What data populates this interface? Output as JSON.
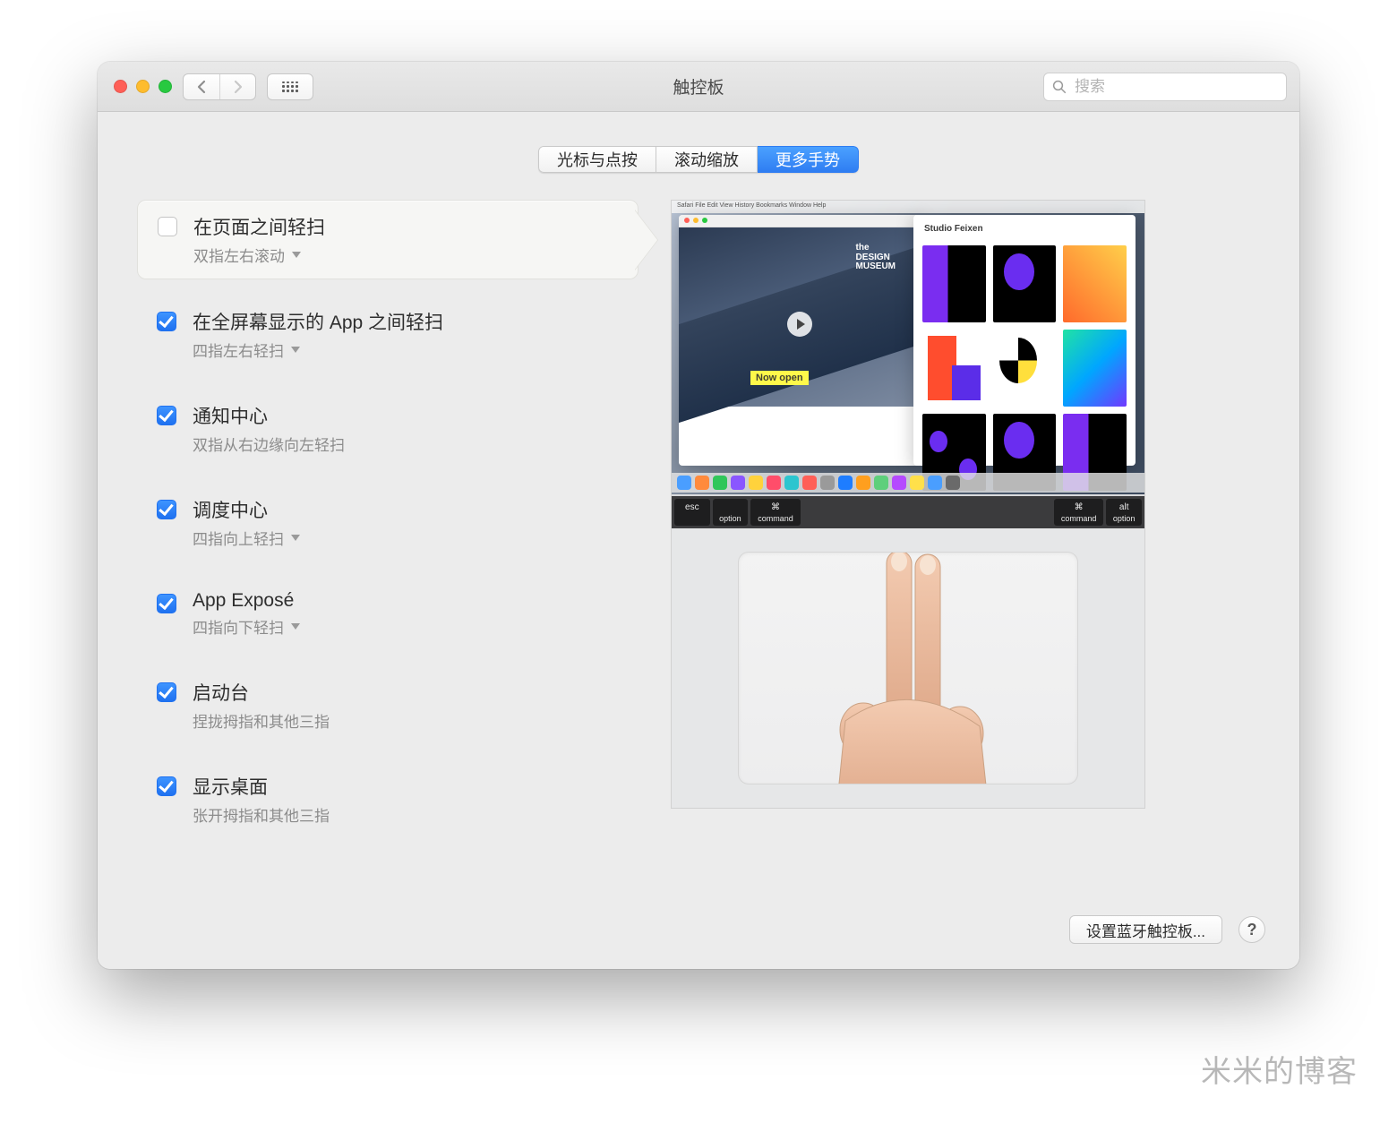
{
  "window": {
    "title": "触控板"
  },
  "search": {
    "placeholder": "搜索"
  },
  "tabs": [
    {
      "label": "光标与点按",
      "active": false
    },
    {
      "label": "滚动缩放",
      "active": false
    },
    {
      "label": "更多手势",
      "active": true
    }
  ],
  "options": [
    {
      "title": "在页面之间轻扫",
      "sub": "双指左右滚动",
      "checked": false,
      "dropdown": true,
      "highlight": true
    },
    {
      "title": "在全屏幕显示的 App 之间轻扫",
      "sub": "四指左右轻扫",
      "checked": true,
      "dropdown": true,
      "highlight": false
    },
    {
      "title": "通知中心",
      "sub": "双指从右边缘向左轻扫",
      "checked": true,
      "dropdown": false,
      "highlight": false
    },
    {
      "title": "调度中心",
      "sub": "四指向上轻扫",
      "checked": true,
      "dropdown": true,
      "highlight": false
    },
    {
      "title": "App Exposé",
      "sub": "四指向下轻扫",
      "checked": true,
      "dropdown": true,
      "highlight": false
    },
    {
      "title": "启动台",
      "sub": "捏拢拇指和其他三指",
      "checked": true,
      "dropdown": false,
      "highlight": false
    },
    {
      "title": "显示桌面",
      "sub": "张开拇指和其他三指",
      "checked": true,
      "dropdown": false,
      "highlight": false
    }
  ],
  "preview": {
    "menu_bar": "Safari  File  Edit  View  History  Bookmarks  Window  Help",
    "design_museum": "the\nDESIGN\nMUSEUM",
    "now_open": "Now open",
    "studio": "Studio Feixen",
    "keys": {
      "esc": "esc",
      "cmd_sym": "⌘",
      "command": "command",
      "option": "option",
      "alt": "alt"
    }
  },
  "footer": {
    "bluetooth": "设置蓝牙触控板...",
    "help": "?"
  },
  "watermark": "米米的博客"
}
